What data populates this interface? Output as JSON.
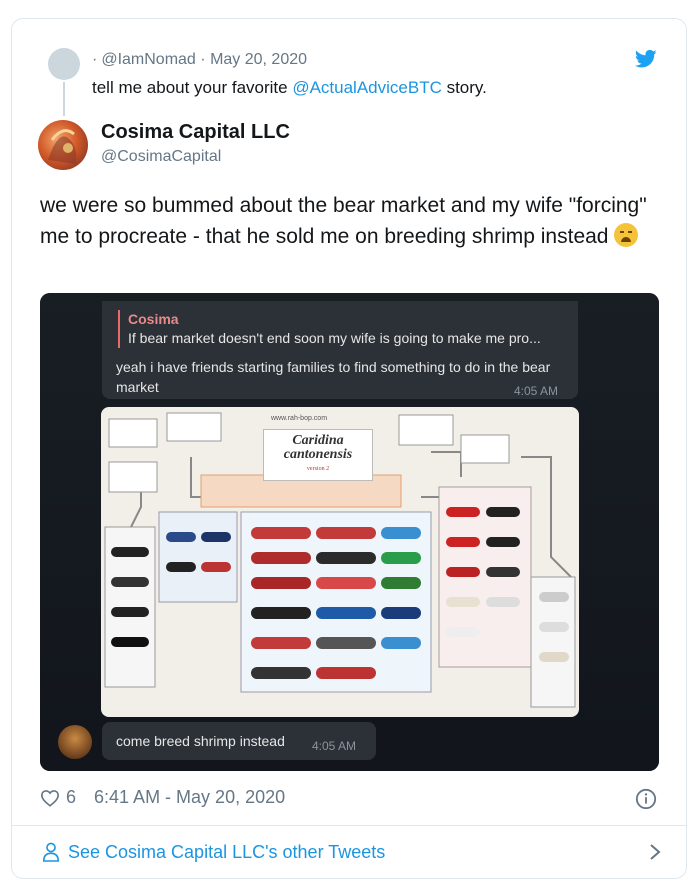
{
  "parent_tweet": {
    "meta_prefix": "·",
    "handle": "@IamNomad",
    "separator": "·",
    "date": "May 20, 2020",
    "text_before": "tell me about your favorite ",
    "mention": "@ActualAdviceBTC",
    "text_after": " story."
  },
  "author": {
    "name": "Cosima Capital LLC",
    "handle": "@CosimaCapital"
  },
  "tweet": {
    "text": "we were so bummed about the bear market and my wife \"forcing\" me to procreate - that he sold me on breeding shrimp instead"
  },
  "media": {
    "quote_name": "Cosima",
    "quote_text": "If bear market doesn't end soon my wife is going to make me pro...",
    "reply_text": "yeah i have friends starting families to find something to do in the bear market",
    "reply_time": "4:05 AM",
    "infographic_url": "www.rah-bop.com",
    "infographic_title_1": "Caridina",
    "infographic_title_2": "cantonensis",
    "infographic_sub": "version 2",
    "second_message": "come breed shrimp instead",
    "second_time": "4:05 AM"
  },
  "stats": {
    "likes": "6",
    "timestamp": "6:41 AM - May 20, 2020"
  },
  "footer": {
    "link": "See Cosima Capital LLC's other Tweets"
  },
  "colors": {
    "link": "#1b95e0",
    "secondary": "#657786",
    "border": "#e1e8ed"
  },
  "icons": [
    "twitter-bird-icon",
    "heart-icon",
    "info-icon",
    "person-icon",
    "chevron-right-icon"
  ]
}
